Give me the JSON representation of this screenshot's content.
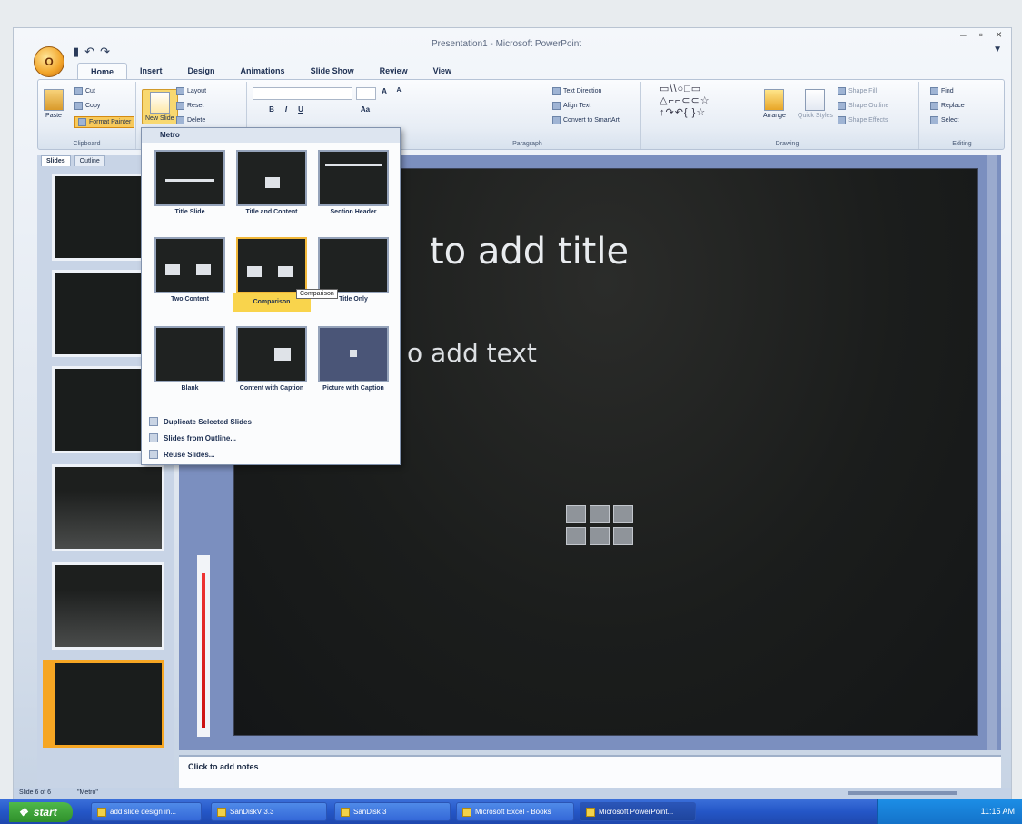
{
  "window": {
    "title": "Presentation1 - Microsoft PowerPoint",
    "controls": [
      "–",
      "▫",
      "×"
    ]
  },
  "office_button": {
    "label": "O"
  },
  "qat": {
    "save": "▮",
    "undo": "↶",
    "redo": "↷"
  },
  "tabs": [
    "Home",
    "Insert",
    "Design",
    "Animations",
    "Slide Show",
    "Review",
    "View"
  ],
  "ribbon": {
    "clipboard": {
      "paste": "Paste",
      "cut": "Cut",
      "copy": "Copy",
      "format_painter": "Format Painter",
      "label": "Clipboard"
    },
    "slides": {
      "new_slide": "New Slide",
      "layout": "Layout",
      "reset": "Reset",
      "delete": "Delete"
    },
    "font": {
      "grow": "A",
      "shrink": "A",
      "bold": "B",
      "italic": "I",
      "underline": "U",
      "aa": "Aa"
    },
    "paragraph": {
      "text_direction": "Text Direction",
      "align_text": "Align Text",
      "convert": "Convert to SmartArt",
      "label": "Paragraph"
    },
    "drawing": {
      "shapes": "▭\\\\○□▭\n△⌐⌐⊂⊂☆\n↑↷↶{ }☆",
      "arrange": "Arrange",
      "quick_styles": "Quick Styles",
      "shape_fill": "Shape Fill",
      "shape_outline": "Shape Outline",
      "shape_effects": "Shape Effects",
      "label": "Drawing"
    },
    "editing": {
      "find": "Find",
      "replace": "Replace",
      "select": "Select",
      "label": "Editing"
    }
  },
  "slides_pane": {
    "tabs": [
      "Slides",
      "Outline"
    ]
  },
  "layout_menu": {
    "header": "Metro",
    "layouts": [
      "Title Slide",
      "Title and Content",
      "Section Header",
      "Two Content",
      "Comparison",
      "Title Only",
      "Blank",
      "Content with Caption",
      "Picture with Caption"
    ],
    "tooltip": "Comparison",
    "commands": [
      "Duplicate Selected Slides",
      "Slides from Outline...",
      "Reuse Slides..."
    ]
  },
  "slide": {
    "title": "to add title",
    "body": "o add text"
  },
  "notes": {
    "placeholder": "Click to add notes"
  },
  "statusbar": {
    "slide": "Slide 6 of 6",
    "theme": "\"Metro\""
  },
  "taskbar": {
    "start": "start",
    "tasks": [
      "add slide design in...",
      "SanDiskV 3.3",
      "SanDisk 3",
      "Microsoft Excel - Books",
      "Microsoft PowerPoint..."
    ],
    "clock": "11:15 AM"
  }
}
